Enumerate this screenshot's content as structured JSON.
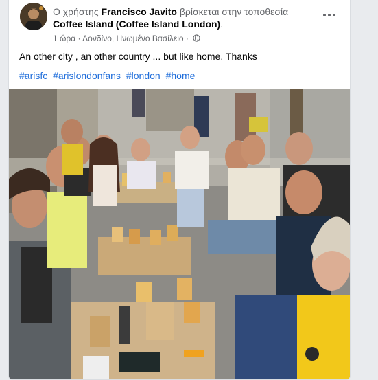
{
  "post": {
    "prefix": "Ο χρήστης",
    "author": "Francisco Javito",
    "middle": "βρίσκεται στην τοποθεσία",
    "place": "Coffee Island (Coffee Island London)",
    "suffix": ".",
    "time": "1 ώρα",
    "separator": " · ",
    "location": "Λονδίνο, Ηνωμένο Βασίλειο",
    "separator2": " · ",
    "caption": "An other city , an other country ... but like home. Thanks",
    "hashtags": [
      "#arisfc",
      "#arislondonfans",
      "#london",
      "#home"
    ]
  },
  "icons": {
    "more": "more-horizontal-icon",
    "audience": "globe-icon"
  },
  "colors": {
    "link": "#216fdb",
    "secondary_text": "#65676b",
    "shirt_yellow": "#f2c81a"
  }
}
